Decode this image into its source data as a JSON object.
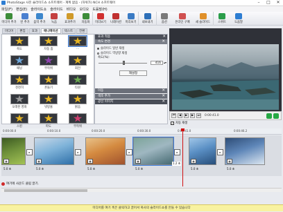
{
  "window": {
    "title": "PhotoStage 사진 슬라이드쇼 소프트웨어 - 계획 없음 - (하위가) NCH 소프트웨어"
  },
  "menubar": {
    "items": [
      "파일(F)",
      "편집(E)",
      "슬라이드쇼",
      "슬라이드",
      "비디오",
      "오디오",
      "도움말(H)"
    ]
  },
  "toolbar": {
    "items": [
      {
        "label": "미디어 추가",
        "color": "#3c8c3a"
      },
      {
        "label": "빈 추가",
        "color": "#4a7fd0"
      },
      {
        "label": "음악 추가",
        "color": "#3c86cc"
      },
      {
        "label": "녹음",
        "color": "#c44040"
      },
      {
        "label": "효과추가",
        "color": "#d09a2a"
      },
      {
        "label": "자동화",
        "color": "#3c8c3a"
      },
      {
        "label": "미리보기",
        "color": "#d03030"
      },
      {
        "label": "나레이션",
        "color": "#c03030"
      },
      {
        "label": "미리보기",
        "color": "#3b7bc4"
      },
      {
        "label": "내보내기",
        "color": "#2d6fb8"
      },
      {
        "label": "옵션",
        "color": "#7a7a7a"
      },
      {
        "label": "온라인 구매",
        "color": "#d05050"
      },
      {
        "label": "새 슬라이드",
        "color": "#e0902a"
      },
      {
        "label": "스위트",
        "color": "#2a9d4a"
      },
      {
        "label": "도움말",
        "color": "#2d7dd2"
      }
    ]
  },
  "left_tabs": [
    "미디어",
    "편집",
    "효과",
    "애니메이션",
    "텍스트",
    "전환"
  ],
  "active_left_tab": "애니메이션",
  "transitions": [
    {
      "label": "속도",
      "color": "#e6b420"
    },
    {
      "label": "자동 줌",
      "color": "#e6b420"
    },
    {
      "label": "…",
      "color": "#e6b420"
    },
    {
      "label": "패닝",
      "color": "#6fa8dc"
    },
    {
      "label": "무작위",
      "color": "#8e44ad"
    },
    {
      "label": "회전",
      "color": "#e6b420"
    },
    {
      "label": "천천히",
      "color": "#e6b420"
    },
    {
      "label": "흔들기",
      "color": "#e6b420"
    },
    {
      "label": "타원",
      "color": "#6aa84f"
    },
    {
      "label": "오래된 영화",
      "color": "#999999"
    },
    {
      "label": "빗방울",
      "color": "#e6b420"
    },
    {
      "label": "밝음",
      "color": "#e6b420"
    },
    {
      "label": "스핀",
      "color": "#e6b420"
    },
    {
      "label": "파도",
      "color": "#e6b420"
    },
    {
      "label": "무작위",
      "color": "#cc3f6f"
    }
  ],
  "effects_panel": {
    "header": "효과 적용",
    "section_title": "속도 변경",
    "radio_options": [
      "슬라이드 일반 재생",
      "슬라이드 역방향 재생"
    ],
    "selected_radio_index": 0,
    "speed_label": "속도(%):",
    "speed_value": "416",
    "speed_fraction": 0.52,
    "apply_button": "재설정",
    "collapsed_sections": [
      "이동",
      "색조 추가",
      "광선 이미지"
    ]
  },
  "preview": {
    "time": "0:00:41.0",
    "autoplay_label": "자동 재생",
    "autoplay_checked": true
  },
  "ruler": {
    "labels": [
      "0:00:00.0",
      "0:00:10.0",
      "0:00:20.0",
      "0:00:30.0",
      "0:00:41.0",
      "0:00:46.2"
    ]
  },
  "timeline": {
    "clips": [
      {
        "duration": "5.0 초",
        "colors": [
          "#6d8f3a",
          "#a3c255",
          "#3c5a22"
        ]
      },
      {
        "duration": "5.0 초",
        "colors": [
          "#7fb3d9",
          "#2e6fa8",
          "#c9d8e8"
        ]
      },
      {
        "duration": "5.0 초",
        "colors": [
          "#d48a40",
          "#a0522d",
          "#e8c28a"
        ]
      },
      {
        "duration": "5.0 초",
        "colors": [
          "#9fb7c1",
          "#466a72",
          "#7da59a"
        ]
      },
      {
        "duration": "5.0 초",
        "colors": [
          "#5a8fc4",
          "#274e7a",
          "#a0c6e8"
        ]
      },
      {
        "duration": "5.0 초",
        "colors": [
          "#5e86b8",
          "#dbe6f0",
          "#2e4d77"
        ]
      }
    ],
    "selected_clip_index": 3,
    "selected_clip_marker": "1.2 초"
  },
  "sound_track": {
    "label": "여기에 사운드 클립 끌기."
  },
  "status_bar": {
    "text": "미디어를 여기 혹은 클릭하고 끌어서 복사의 슬라이드쇼를 만들 수 있습니다"
  }
}
